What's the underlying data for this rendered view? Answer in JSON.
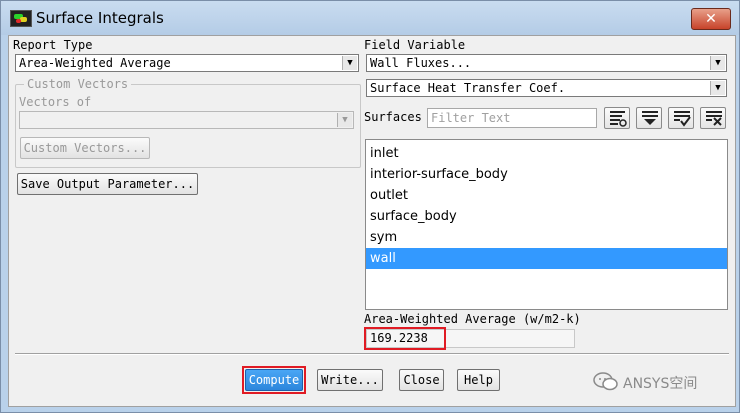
{
  "window": {
    "title": "Surface Integrals",
    "close_glyph": "✕"
  },
  "report_type": {
    "label": "Report Type",
    "value": "Area-Weighted Average"
  },
  "custom_vectors": {
    "group_title": "Custom Vectors",
    "vectors_of_label": "Vectors of",
    "vectors_of_value": "",
    "button_label": "Custom Vectors..."
  },
  "save_output_button": "Save Output Parameter...",
  "field_variable": {
    "label": "Field Variable",
    "category": "Wall Fluxes...",
    "variable": "Surface Heat Transfer Coef."
  },
  "surfaces": {
    "label": "Surfaces",
    "filter_placeholder": "Filter Text",
    "toolbar_icons": [
      "select-all-icon",
      "deselect-all-icon",
      "check-list-icon",
      "clear-list-icon"
    ],
    "items": [
      {
        "label": "inlet",
        "selected": false
      },
      {
        "label": "interior-surface_body",
        "selected": false
      },
      {
        "label": "outlet",
        "selected": false
      },
      {
        "label": "surface_body",
        "selected": false
      },
      {
        "label": "sym",
        "selected": false
      },
      {
        "label": "wall",
        "selected": true
      }
    ]
  },
  "result": {
    "label": "Area-Weighted Average (w/m2-k)",
    "value": "169.2238"
  },
  "buttons": {
    "compute": "Compute",
    "write": "Write...",
    "close": "Close",
    "help": "Help"
  },
  "watermark": {
    "text": "ANSYS空间",
    "icon": "wechat-icon"
  },
  "colors": {
    "selection": "#3399ff",
    "highlight": "#e01b24",
    "compute_button": "#2c86dc"
  }
}
